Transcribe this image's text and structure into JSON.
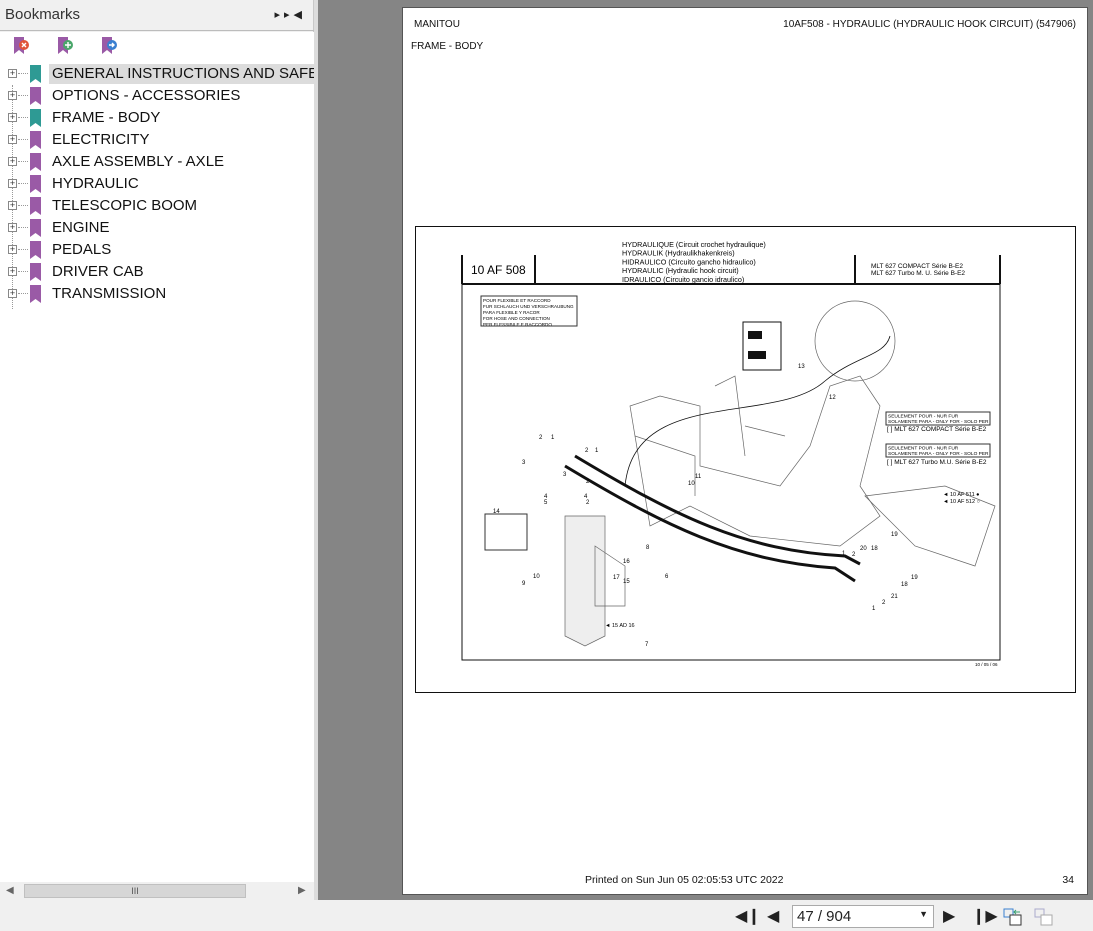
{
  "bookmarks": {
    "title": "Bookmarks",
    "toolbar": [
      "remove-bookmark-icon",
      "add-bookmark-icon",
      "go-to-bookmark-icon"
    ],
    "items": [
      {
        "label": "GENERAL INSTRUCTIONS AND SAFETY",
        "color": "#2e9a94",
        "selected": true
      },
      {
        "label": "OPTIONS - ACCESSORIES",
        "color": "#9a5aa6"
      },
      {
        "label": "FRAME - BODY",
        "color": "#2e9a94"
      },
      {
        "label": "ELECTRICITY",
        "color": "#9a5aa6"
      },
      {
        "label": "AXLE ASSEMBLY - AXLE",
        "color": "#9a5aa6"
      },
      {
        "label": "HYDRAULIC",
        "color": "#9a5aa6"
      },
      {
        "label": "TELESCOPIC BOOM",
        "color": "#9a5aa6"
      },
      {
        "label": "ENGINE",
        "color": "#9a5aa6"
      },
      {
        "label": "PEDALS",
        "color": "#9a5aa6"
      },
      {
        "label": "DRIVER CAB",
        "color": "#9a5aa6"
      },
      {
        "label": "TRANSMISSION",
        "color": "#9a5aa6"
      }
    ],
    "scroll_grip": "III"
  },
  "page": {
    "brand": "MANITOU",
    "doc_title": "10AF508 - HYDRAULIC (HYDRAULIC HOOK CIRCUIT) (547906)",
    "section": "FRAME - BODY",
    "printed": "Printed on  Sun Jun 05 02:05:53 UTC 2022",
    "page_number": "34",
    "drawing": {
      "code": "10 AF 508",
      "titles": [
        "HYDRAULIQUE (Circuit crochet hydraulique)",
        "HYDRAULIK (Hydraulikhakenkreis)",
        "HIDRAULICO (Circuito gancho hidraulico)",
        "HYDRAULIC (Hydraulic hook circuit)",
        "IDRAULICO (Circuito gancio idraulico)"
      ],
      "models": [
        "MLT 627 COMPACT Série B-E2",
        "MLT 627 Turbo M. U. Série B-E2"
      ],
      "hose_note": [
        "POUR FLEXIBLE ET RACCORD",
        "FUR SCHLAUCH UND VERSCHRAUBUNG",
        "PARA FLEXIBLE Y RACOR",
        "FOR HOSE AND CONNECTION",
        "PER FLESSIBILE E RACCORDO"
      ],
      "only_for": [
        "SEULEMENT POUR - NUR FUR",
        "SOLAMENTE PARA - ONLY FOR - SOLO PER"
      ],
      "variant1": "[ ] MLT 627 COMPACT Série B-E2",
      "variant2": "[ ] MLT 627 Turbo M.U. Série B-E2",
      "refs": [
        "◄ 10 AF 511 ●",
        "◄ 10 AF 512 ○"
      ],
      "ref_15ad16": "◄ 15 AD 16",
      "date": "10 / 05 / 06",
      "callouts": [
        "1",
        "2",
        "3",
        "2",
        "1",
        "2",
        "3",
        "4",
        "5",
        "4",
        "2",
        "14",
        "9",
        "10",
        "15",
        "16",
        "17",
        "8",
        "6",
        "10",
        "11",
        "12",
        "13",
        "7",
        "1",
        "2",
        "20",
        "18",
        "19",
        "19",
        "18",
        "2",
        "21",
        "1"
      ]
    }
  },
  "toolbar": {
    "page_value": "47 / 904"
  }
}
